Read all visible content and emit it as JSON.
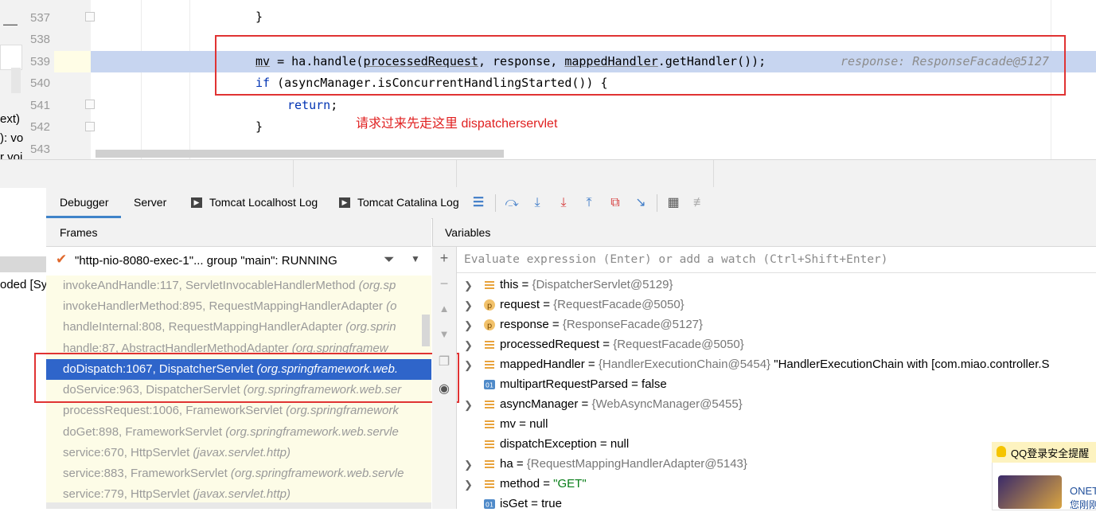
{
  "editor": {
    "line_numbers": [
      "537",
      "538",
      "539",
      "540",
      "541",
      "542",
      "543"
    ],
    "lines": {
      "l537": "}",
      "l539_a": "mv",
      "l539_b": " = ha.handle(",
      "l539_c": "processedRequest",
      "l539_d": ", response, ",
      "l539_e": "mappedHandler",
      "l539_f": ".getHandler());",
      "l539_hint": "response: ResponseFacade@5127",
      "l540_a": "if",
      "l540_b": " (asyncManager.isConcurrentHandlingStarted()) {",
      "l541_a": "return",
      "l541_b": ";",
      "l542": "}"
    },
    "annotation": "请求过来先走这里 dispatcherservlet"
  },
  "left_fragments": [
    "ext)",
    "): vo",
    "r voi",
    "oded [Sy"
  ],
  "tabs": [
    "Debugger",
    "Server",
    "Tomcat Localhost Log",
    "Tomcat Catalina Log"
  ],
  "toolbar_icons": [
    "menu-icon",
    "step-over-icon",
    "step-into-icon",
    "force-step-into-icon",
    "step-out-icon",
    "drop-frame-icon",
    "run-to-cursor-icon",
    "evaluate-icon",
    "trace-icon"
  ],
  "frames": {
    "header": "Frames",
    "thread": "\"http-nio-8080-exec-1\"... group \"main\": RUNNING",
    "items": [
      {
        "method": "invokeAndHandle:117, ServletInvocableHandlerMethod ",
        "pkg": "(org.sp"
      },
      {
        "method": "invokeHandlerMethod:895, RequestMappingHandlerAdapter ",
        "pkg": "(o"
      },
      {
        "method": "handleInternal:808, RequestMappingHandlerAdapter ",
        "pkg": "(org.sprin"
      },
      {
        "method": "handle:87, AbstractHandlerMethodAdapter ",
        "pkg": "(org.springframew"
      },
      {
        "method": "doDispatch:1067, DispatcherServlet ",
        "pkg": "(org.springframework.web."
      },
      {
        "method": "doService:963, DispatcherServlet ",
        "pkg": "(org.springframework.web.ser"
      },
      {
        "method": "processRequest:1006, FrameworkServlet ",
        "pkg": "(org.springframework"
      },
      {
        "method": "doGet:898, FrameworkServlet ",
        "pkg": "(org.springframework.web.servle"
      },
      {
        "method": "service:670, HttpServlet ",
        "pkg": "(javax.servlet.http)"
      },
      {
        "method": "service:883, FrameworkServlet ",
        "pkg": "(org.springframework.web.servle"
      },
      {
        "method": "service:779, HttpServlet ",
        "pkg": "(javax.servlet.http)"
      }
    ]
  },
  "variables": {
    "header": "Variables",
    "eval_placeholder": "Evaluate expression (Enter) or add a watch (Ctrl+Shift+Enter)",
    "items": [
      {
        "name": "this",
        "eq": " = ",
        "val": "{DispatcherServlet@5129}",
        "extra": ""
      },
      {
        "name": "request",
        "eq": " = ",
        "val": "{RequestFacade@5050}",
        "extra": ""
      },
      {
        "name": "response",
        "eq": " = ",
        "val": "{ResponseFacade@5127}",
        "extra": ""
      },
      {
        "name": "processedRequest",
        "eq": " = ",
        "val": "{RequestFacade@5050}",
        "extra": ""
      },
      {
        "name": "mappedHandler",
        "eq": " = ",
        "val": "{HandlerExecutionChain@5454}",
        "extra": " \"HandlerExecutionChain with [com.miao.controller.S"
      },
      {
        "name": "multipartRequestParsed",
        "eq": " = ",
        "val": "false",
        "extra": ""
      },
      {
        "name": "asyncManager",
        "eq": " = ",
        "val": "{WebAsyncManager@5455}",
        "extra": ""
      },
      {
        "name": "mv",
        "eq": " = ",
        "val": "null",
        "extra": ""
      },
      {
        "name": "dispatchException",
        "eq": " = ",
        "val": "null",
        "extra": ""
      },
      {
        "name": "ha",
        "eq": " = ",
        "val": "{RequestMappingHandlerAdapter@5143}",
        "extra": ""
      },
      {
        "name": "method",
        "eq": " = ",
        "val": "\"GET\"",
        "extra": ""
      },
      {
        "name": "isGet",
        "eq": " = ",
        "val": "true",
        "extra": ""
      }
    ]
  },
  "qq_popup": {
    "title": "QQ登录安全提醒",
    "line1": "ONET",
    "line2": "您刚刚"
  },
  "colors": {
    "highlight": "#c7d5f0",
    "selection": "#2f65ca",
    "redbox": "#e03333",
    "keyword": "#0033b3"
  }
}
